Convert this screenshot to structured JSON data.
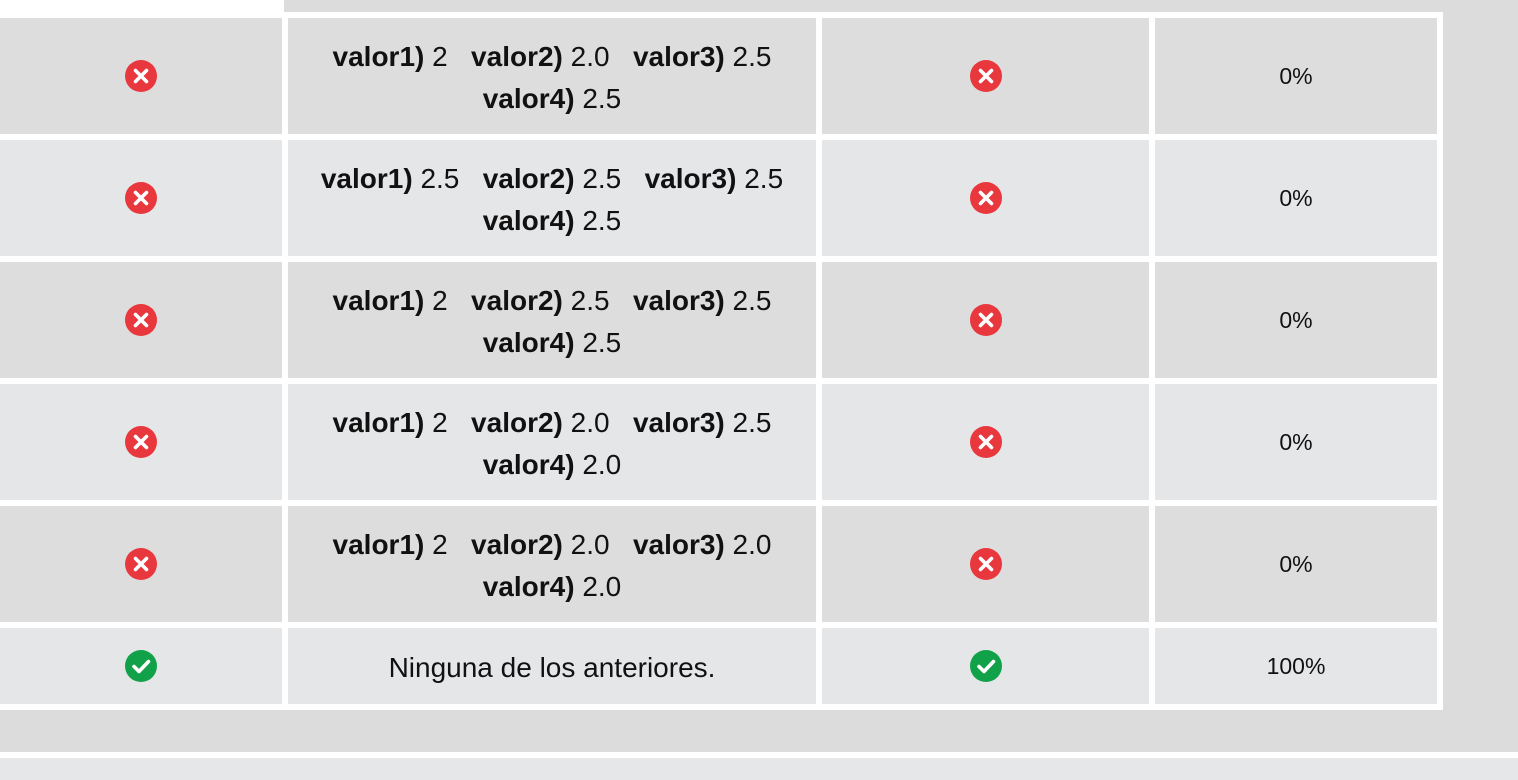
{
  "icons": {
    "wrong": "x-circle-icon",
    "correct": "check-circle-icon"
  },
  "colors": {
    "wrong": "#e8383d",
    "correct": "#11a149"
  },
  "rows": [
    {
      "kind": "wrong",
      "v1_label": "valor1)",
      "v1": "2",
      "v2_label": "valor2)",
      "v2": "2.0",
      "v3_label": "valor3)",
      "v3": "2.5",
      "v4_label": "valor4)",
      "v4": "2.5",
      "percent": "0%"
    },
    {
      "kind": "wrong",
      "v1_label": "valor1)",
      "v1": "2.5",
      "v2_label": "valor2)",
      "v2": "2.5",
      "v3_label": "valor3)",
      "v3": "2.5",
      "v4_label": "valor4)",
      "v4": "2.5",
      "percent": "0%"
    },
    {
      "kind": "wrong",
      "v1_label": "valor1)",
      "v1": "2",
      "v2_label": "valor2)",
      "v2": "2.5",
      "v3_label": "valor3)",
      "v3": "2.5",
      "v4_label": "valor4)",
      "v4": "2.5",
      "percent": "0%"
    },
    {
      "kind": "wrong",
      "v1_label": "valor1)",
      "v1": "2",
      "v2_label": "valor2)",
      "v2": "2.0",
      "v3_label": "valor3)",
      "v3": "2.5",
      "v4_label": "valor4)",
      "v4": "2.0",
      "percent": "0%"
    },
    {
      "kind": "wrong",
      "v1_label": "valor1)",
      "v1": "2",
      "v2_label": "valor2)",
      "v2": "2.0",
      "v3_label": "valor3)",
      "v3": "2.0",
      "v4_label": "valor4)",
      "v4": "2.0",
      "percent": "0%"
    }
  ],
  "last_row": {
    "kind": "correct",
    "text": "Ninguna de los anteriores.",
    "percent": "100%"
  }
}
